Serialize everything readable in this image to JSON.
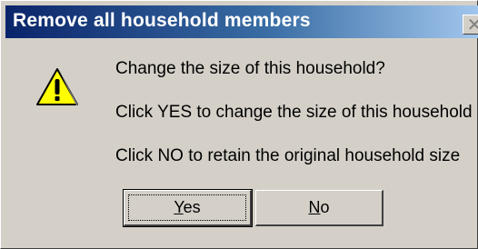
{
  "window": {
    "title": "Remove all household members",
    "close_glyph": "✕"
  },
  "icon": "warning-icon",
  "message": {
    "line1": "Change the size of this household?",
    "line2": "Click YES to change the size of this household",
    "line3": "Click NO to retain the original household size"
  },
  "buttons": {
    "yes_mnemonic": "Y",
    "yes_rest": "es",
    "no_mnemonic": "N",
    "no_rest": "o"
  },
  "colors": {
    "title_start": "#0a246a",
    "title_end": "#a6caf0",
    "face": "#d4d0c8",
    "warning_yellow": "#ffff00"
  }
}
